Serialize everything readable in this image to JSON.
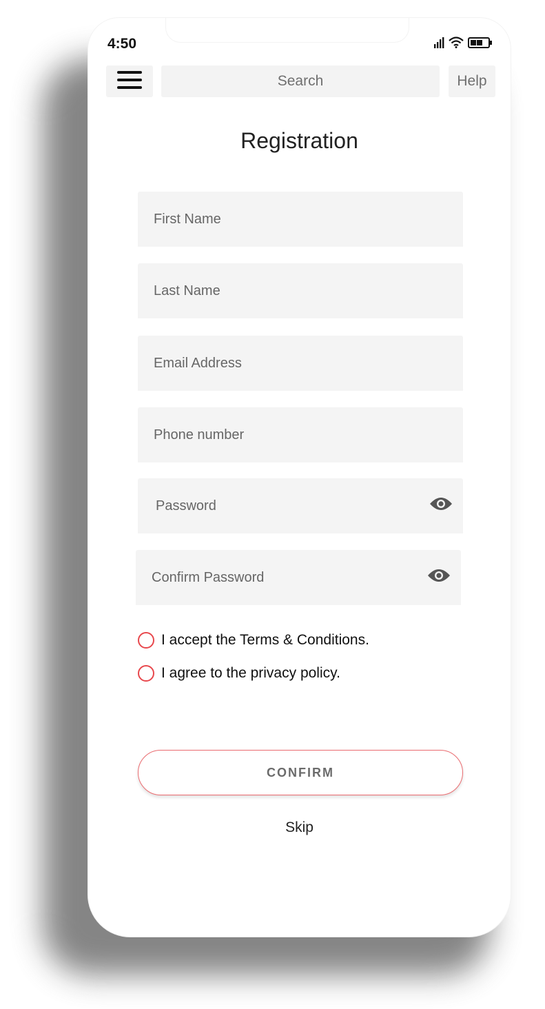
{
  "status_bar": {
    "time": "4:50",
    "icons": [
      "signal-icon",
      "wifi-icon",
      "battery-icon"
    ]
  },
  "toolbar": {
    "menu_icon": "hamburger-menu-icon",
    "search_placeholder": "Search",
    "help_label": "Help"
  },
  "page": {
    "title": "Registration"
  },
  "form": {
    "fields": [
      {
        "name": "first-name",
        "placeholder": "First Name",
        "value": ""
      },
      {
        "name": "last-name",
        "placeholder": "Last Name",
        "value": ""
      },
      {
        "name": "email-address",
        "placeholder": "Email Address",
        "value": ""
      },
      {
        "name": "phone-number",
        "placeholder": "Phone number",
        "value": ""
      },
      {
        "name": "password",
        "placeholder": "Password",
        "value": "",
        "icon": "eye-icon"
      },
      {
        "name": "confirm-password",
        "placeholder": "Confirm Password",
        "value": "",
        "icon": "eye-icon"
      }
    ],
    "checks": [
      {
        "label": "I accept the Terms & Conditions.",
        "checked": false
      },
      {
        "label": "I agree to the privacy policy.",
        "checked": false
      }
    ],
    "confirm_label": "CONFIRM",
    "skip_label": "Skip"
  },
  "colors": {
    "accent": "#e8474c",
    "field_bg": "#f4f4f4",
    "placeholder": "#666666"
  }
}
